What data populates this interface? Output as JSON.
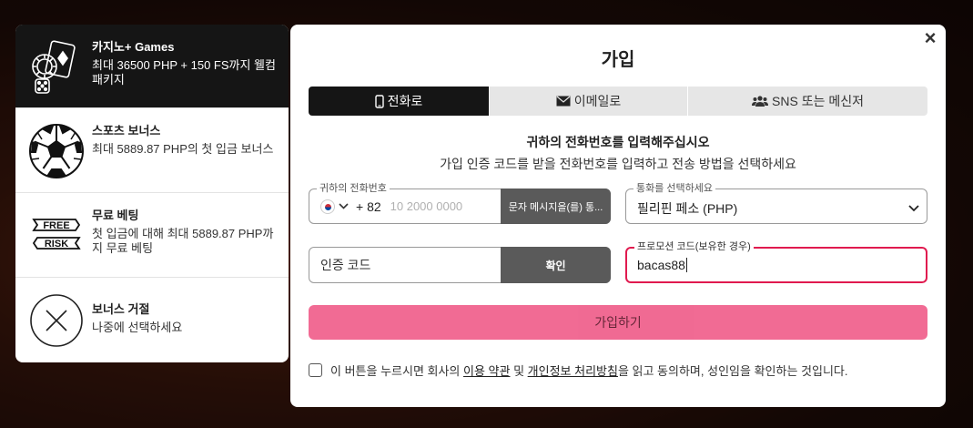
{
  "bonuses": [
    {
      "title": "카지노+ Games",
      "desc": "최대 36500 PHP + 150 FS까지 웰컴 패키지",
      "icon": "casino-cards-icon",
      "selected": true
    },
    {
      "title": "스포츠 보너스",
      "desc": "최대 5889.87 PHP의 첫 입금 보너스",
      "icon": "soccer-ball-icon",
      "selected": false
    },
    {
      "title": "무료 베팅",
      "desc": "첫 입금에 대해 최대 5889.87 PHP까지 무료 베팅",
      "icon": "free-risk-icon",
      "icon_text_1": "FREE",
      "icon_text_2": "RISK",
      "selected": false
    },
    {
      "title": "보너스 거절",
      "desc": "나중에 선택하세요",
      "icon": "reject-x-icon",
      "selected": false
    }
  ],
  "modal": {
    "title": "가입",
    "close_label": "×",
    "tabs": [
      {
        "label": "전화로",
        "icon": "phone-icon",
        "active": true
      },
      {
        "label": "이메일로",
        "icon": "envelope-icon",
        "active": false
      },
      {
        "label": "SNS 또는 메신저",
        "icon": "users-icon",
        "active": false
      }
    ],
    "info_title": "귀하의 전화번호를 입력해주십시오",
    "info_sub": "가입 인증 코드를 받을 전화번호를 입력하고 전송 방법을 선택하세요",
    "phone": {
      "label": "귀하의 전화번호",
      "dial_code": "+ 82",
      "placeholder": "10 2000 0000",
      "send_label": "문자 메시지을(를) 통..."
    },
    "currency": {
      "label": "통화를 선택하세요",
      "value": "필리핀 페소 (PHP)"
    },
    "code": {
      "placeholder": "인증 코드",
      "confirm_label": "확인"
    },
    "promo": {
      "label": "프로모션 코드(보유한 경우)",
      "value": "bacas88"
    },
    "signup_label": "가입하기",
    "terms": {
      "pre": "이 버튼을 누르시면 회사의 ",
      "link1": "이용 약관",
      "mid": " 및 ",
      "link2": "개인정보 처리방침",
      "post": "을 읽고 동의하며, 성인임을 확인하는 것입니다."
    }
  },
  "colors": {
    "accent_pink": "#f0638e",
    "promo_border": "#e01a4f",
    "dark": "#151515"
  }
}
